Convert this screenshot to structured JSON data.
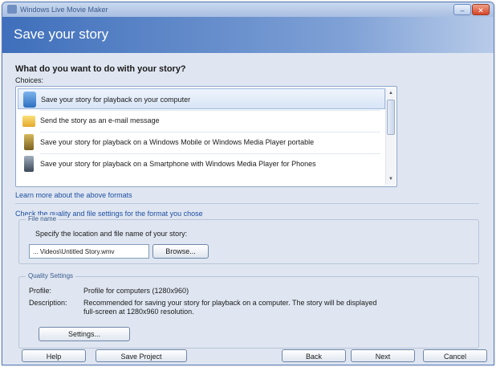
{
  "window": {
    "title": "Windows Live Movie Maker",
    "minimize_glyph": "–",
    "close_glyph": "✕"
  },
  "banner": {
    "title": "Save your story"
  },
  "main": {
    "question": "What do you want to do with your story?",
    "choices_label": "Choices:",
    "choices": [
      {
        "label": "Save your story for playback on your computer",
        "icon": "computer-icon",
        "selected": true
      },
      {
        "label": "Send the story as an e-mail message",
        "icon": "email-envelope-icon"
      },
      {
        "label": "Save your story for playback on a Windows Mobile or Windows Media Player portable",
        "icon": "portable-device-icon"
      },
      {
        "label": "Save your story for playback on a Smartphone with Windows Media Player for Phones",
        "icon": "smartphone-icon"
      }
    ],
    "learn_link": "Learn more about the above formats",
    "defaults_text": "Check the quality and file settings for the format you chose",
    "filename_group": {
      "legend": "File name",
      "prompt": "Specify the location and file name of your story:",
      "value": "... Videos\\Untitled Story.wmv",
      "browse_label": "Browse..."
    },
    "quality_group": {
      "legend": "Quality Settings",
      "profile_label": "Profile:",
      "profile_value": "Profile for computers (1280x960)",
      "desc_label": "Description:",
      "desc_value": "Recommended for saving your story for playback on a computer. The story will be displayed full-screen at 1280x960 resolution.",
      "settings_label": "Settings..."
    }
  },
  "footer": {
    "help": "Help",
    "save_project": "Save Project",
    "back": "Back",
    "next": "Next",
    "cancel": "Cancel"
  }
}
